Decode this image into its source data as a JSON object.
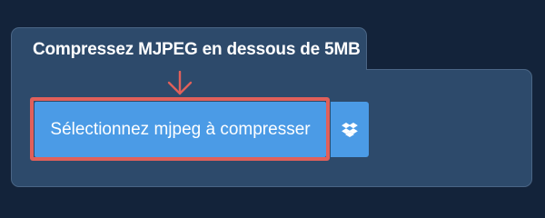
{
  "panel": {
    "title": "Compressez MJPEG en dessous de 5MB"
  },
  "upload": {
    "select_label": "Sélectionnez mjpeg à compresser",
    "cloud_icon": "dropbox-icon",
    "indicator_icon": "arrow-down-icon"
  },
  "colors": {
    "page_background": "#13233a",
    "panel_background": "#2d4a6b",
    "button_background": "#4b9be6",
    "highlight": "#e0605a"
  }
}
